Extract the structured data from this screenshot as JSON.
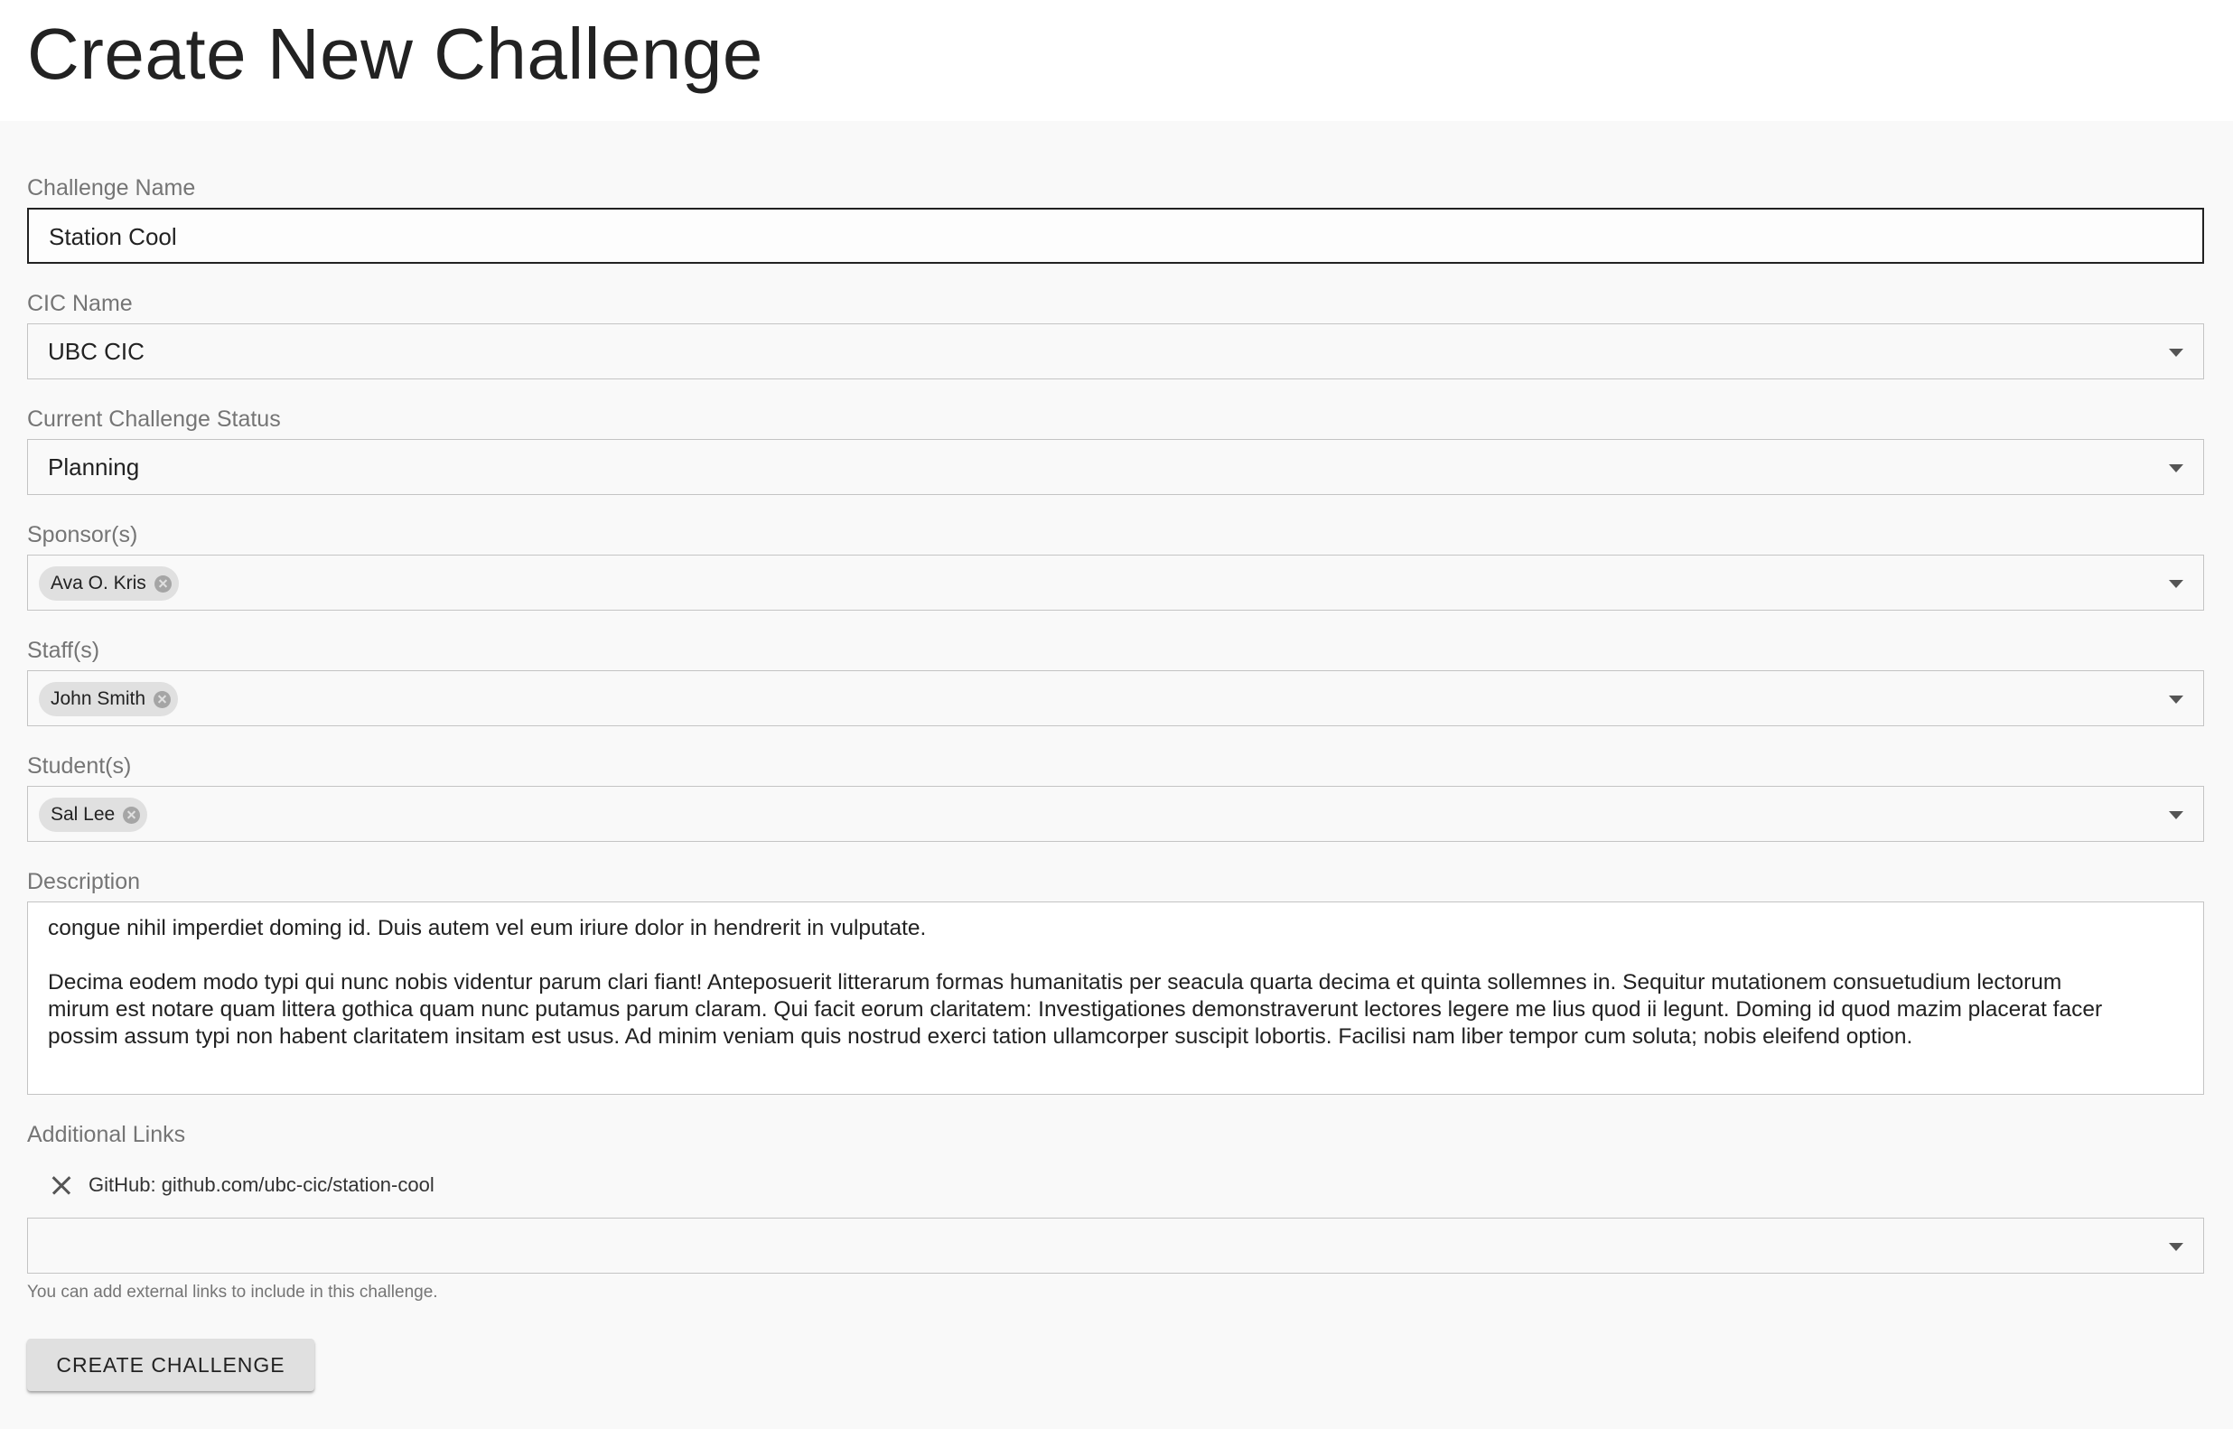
{
  "page": {
    "title": "Create New Challenge"
  },
  "form": {
    "challenge_name": {
      "label": "Challenge Name",
      "value": "Station Cool"
    },
    "cic_name": {
      "label": "CIC Name",
      "value": "UBC CIC"
    },
    "status": {
      "label": "Current Challenge Status",
      "value": "Planning"
    },
    "sponsors": {
      "label": "Sponsor(s)",
      "chips": [
        "Ava O. Kris"
      ]
    },
    "staff": {
      "label": "Staff(s)",
      "chips": [
        "John Smith"
      ]
    },
    "students": {
      "label": "Student(s)",
      "chips": [
        "Sal Lee"
      ]
    },
    "description": {
      "label": "Description",
      "paragraph1": "congue nihil imperdiet doming id. Duis autem vel eum iriure dolor in hendrerit in vulputate.",
      "paragraph2": "Decima eodem modo typi qui nunc nobis videntur parum clari fiant! Anteposuerit litterarum formas humanitatis per seacula quarta decima et quinta sollemnes in. Sequitur mutationem consuetudium lectorum mirum est notare quam littera gothica quam nunc putamus parum claram. Qui facit eorum claritatem: Investigationes demonstraverunt lectores legere me lius quod ii legunt. Doming id quod mazim placerat facer possim assum typi non habent claritatem insitam est usus. Ad minim veniam quis nostrud exerci tation ullamcorper suscipit lobortis. Facilisi nam liber tempor cum soluta; nobis eleifend option."
    },
    "links": {
      "label": "Additional Links",
      "items": [
        "GitHub: github.com/ubc-cic/station-cool"
      ],
      "input_value": "",
      "helper": "You can add external links to include in this challenge."
    },
    "submit_label": "CREATE CHALLENGE"
  }
}
